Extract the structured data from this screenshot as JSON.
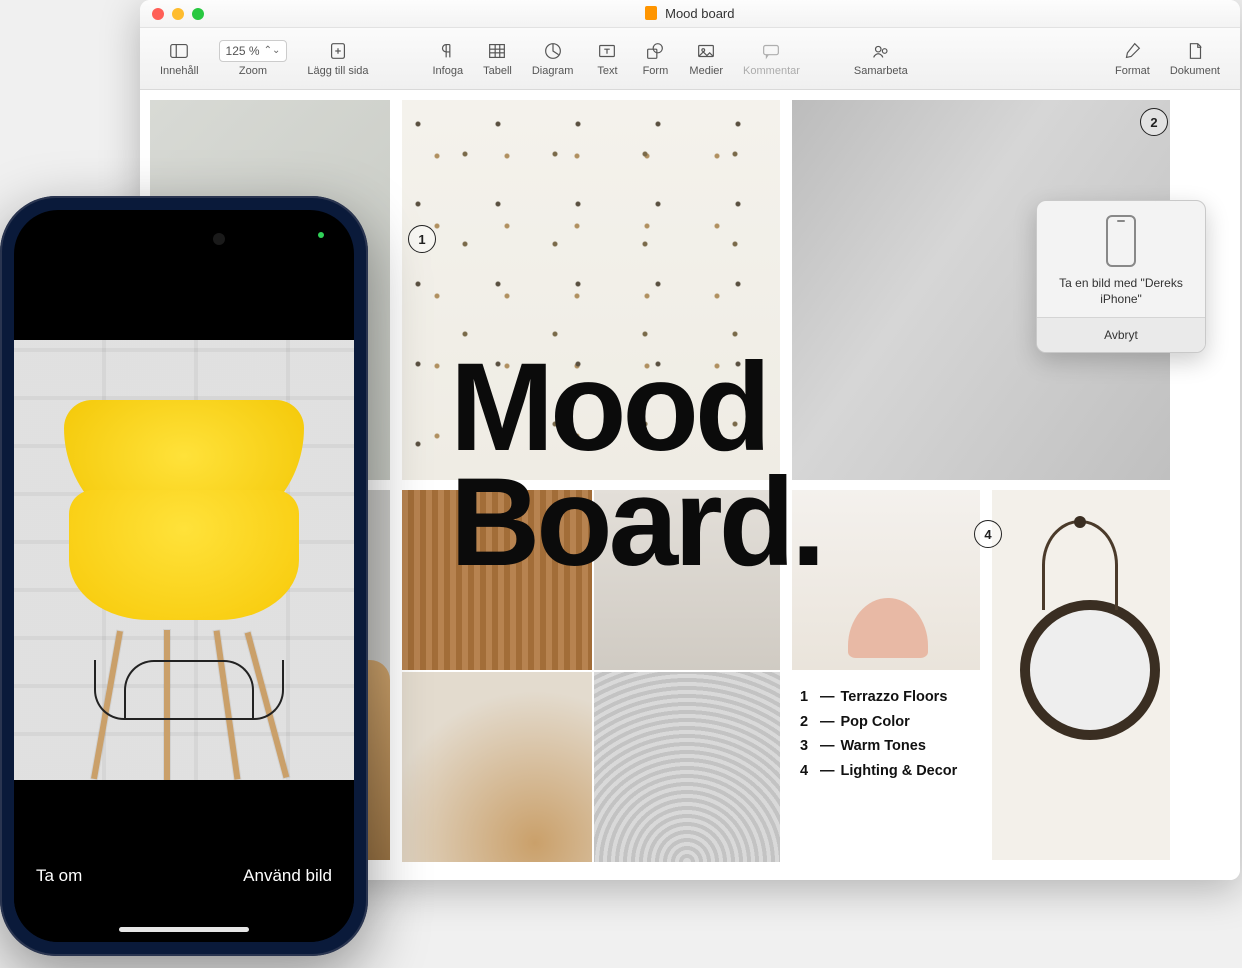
{
  "window": {
    "title": "Mood board"
  },
  "toolbar": {
    "innehall": "Innehåll",
    "zoom_label": "Zoom",
    "zoom_value": "125 %",
    "add_page": "Lägg till sida",
    "infoga": "Infoga",
    "tabell": "Tabell",
    "diagram": "Diagram",
    "text": "Text",
    "form": "Form",
    "medier": "Medier",
    "kommentar": "Kommentar",
    "samarbeta": "Samarbeta",
    "format": "Format",
    "dokument": "Dokument"
  },
  "document": {
    "headline_line1": "Mood",
    "headline_line2": "Board.",
    "callouts": {
      "c1": "1",
      "c2": "2",
      "c4": "4"
    },
    "legend": [
      {
        "n": "1",
        "label": "Terrazzo Floors"
      },
      {
        "n": "2",
        "label": "Pop Color"
      },
      {
        "n": "3",
        "label": "Warm Tones"
      },
      {
        "n": "4",
        "label": "Lighting & Decor"
      }
    ]
  },
  "popover": {
    "message": "Ta en bild med \"Dereks iPhone\"",
    "cancel": "Avbryt"
  },
  "iphone": {
    "retake": "Ta om",
    "use_photo": "Använd bild"
  }
}
